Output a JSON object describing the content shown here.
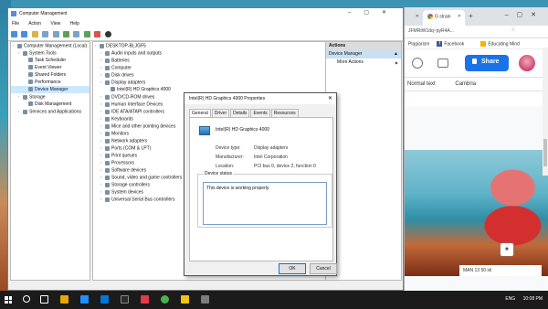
{
  "chrome": {
    "tab1_label": "",
    "tab2_label": "G  strain",
    "new_tab_icon": "plus-icon",
    "controls": "–▢✕",
    "address": "JFMRtW1dq~pyR4A...",
    "bookmarks": [
      "Plagiarism",
      "Facebook",
      "Educating Mind"
    ],
    "share_label": "Share",
    "format_text": [
      "Normal text",
      "Cambria"
    ],
    "status": "MAN 13 50 sli"
  },
  "cm": {
    "title": "Computer Management",
    "menu": [
      "File",
      "Action",
      "View",
      "Help"
    ],
    "controls": "–▢✕",
    "tree_left": [
      {
        "label": "Computer Management (Local)",
        "level": 0
      },
      {
        "label": "System Tools",
        "level": 1
      },
      {
        "label": "Task Scheduler",
        "level": 2
      },
      {
        "label": "Event Viewer",
        "level": 2
      },
      {
        "label": "Shared Folders",
        "level": 2
      },
      {
        "label": "Performance",
        "level": 2
      },
      {
        "label": "Device Manager",
        "level": 2,
        "selected": true
      },
      {
        "label": "Storage",
        "level": 1
      },
      {
        "label": "Disk Management",
        "level": 2
      },
      {
        "label": "Services and Applications",
        "level": 1
      }
    ],
    "tree_middle": [
      {
        "label": "DESKTOP-BLJGF5",
        "level": 0
      },
      {
        "label": "Audio inputs and outputs",
        "level": 1
      },
      {
        "label": "Batteries",
        "level": 1
      },
      {
        "label": "Computer",
        "level": 1
      },
      {
        "label": "Disk drives",
        "level": 1
      },
      {
        "label": "Display adapters",
        "level": 1
      },
      {
        "label": "Intel(R) HD Graphics 4000",
        "level": 2
      },
      {
        "label": "DVD/CD-ROM drives",
        "level": 1
      },
      {
        "label": "Human Interface Devices",
        "level": 1
      },
      {
        "label": "IDE ATA/ATAPI controllers",
        "level": 1
      },
      {
        "label": "Keyboards",
        "level": 1
      },
      {
        "label": "Mice and other pointing devices",
        "level": 1
      },
      {
        "label": "Monitors",
        "level": 1
      },
      {
        "label": "Network adapters",
        "level": 1
      },
      {
        "label": "Ports (COM & LPT)",
        "level": 1
      },
      {
        "label": "Print queues",
        "level": 1
      },
      {
        "label": "Processors",
        "level": 1
      },
      {
        "label": "Software devices",
        "level": 1
      },
      {
        "label": "Sound, video and game controllers",
        "level": 1
      },
      {
        "label": "Storage controllers",
        "level": 1
      },
      {
        "label": "System devices",
        "level": 1
      },
      {
        "label": "Universal Serial Bus controllers",
        "level": 1
      }
    ],
    "actions_header": "Actions",
    "actions_selected": "Device Manager",
    "actions_more": "More Actions"
  },
  "dialog": {
    "title": "Intel(R) HD Graphics 4000 Properties",
    "close": "✕",
    "tabs": [
      "General",
      "Driver",
      "Details",
      "Events",
      "Resources"
    ],
    "active_tab": 0,
    "device_name": "Intel(R) HD Graphics 4000",
    "fields": [
      {
        "key": "Device type:",
        "value": "Display adapters"
      },
      {
        "key": "Manufacturer:",
        "value": "Intel Corporation"
      },
      {
        "key": "Location:",
        "value": "PCI bus 0, device 2, function 0"
      }
    ],
    "status_group": "Device status",
    "status_text": "This device is working properly.",
    "ok": "OK",
    "cancel": "Cancel"
  },
  "taskbar": {
    "lang": "ENG",
    "time": "10:08 PM"
  }
}
